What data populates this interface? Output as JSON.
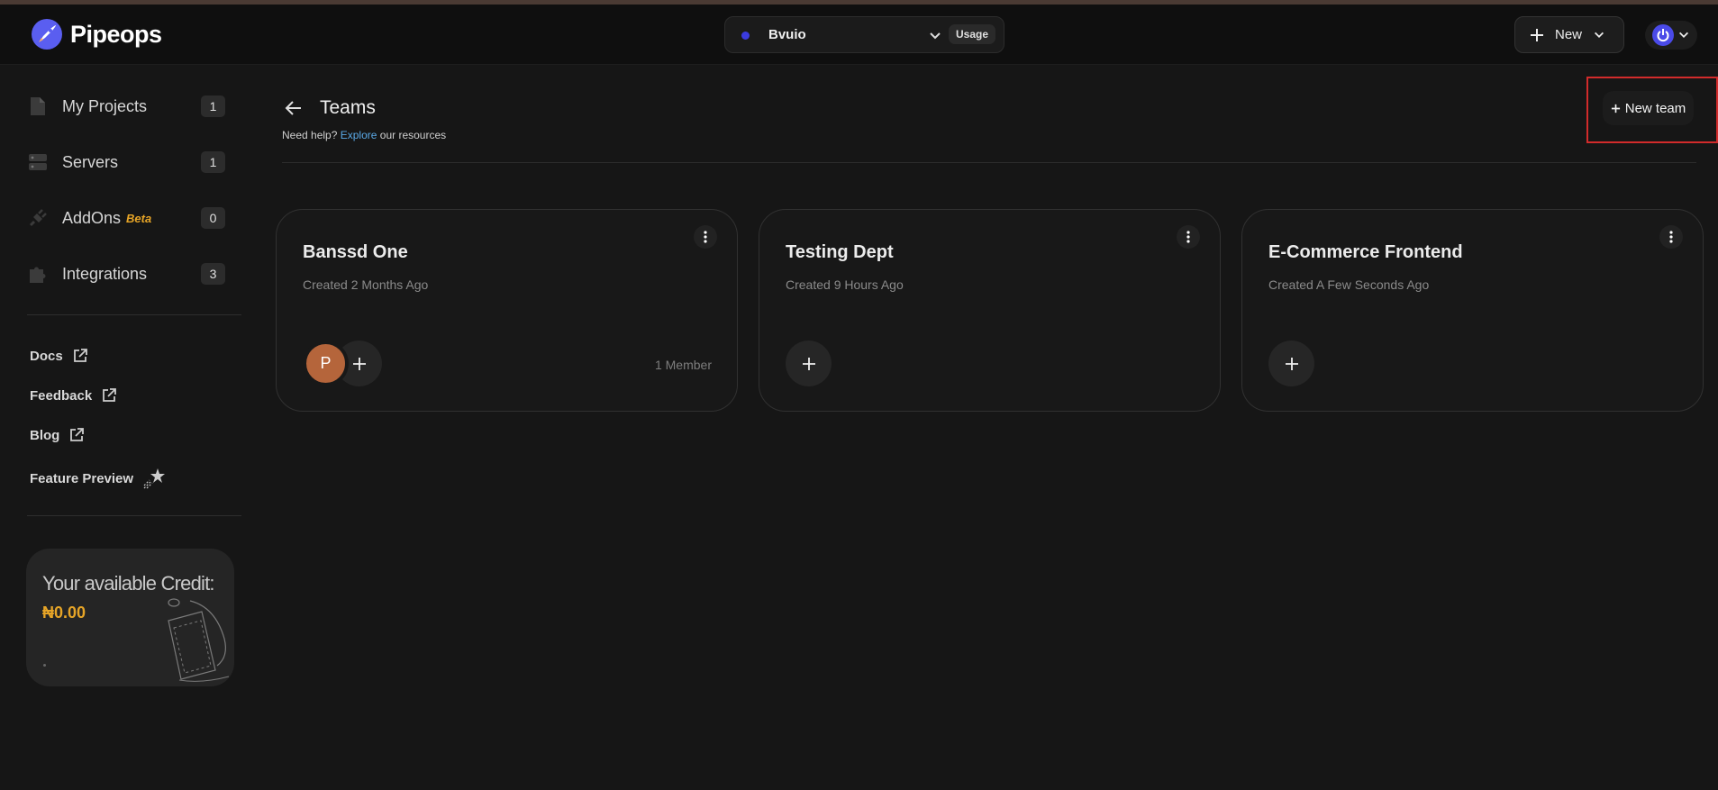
{
  "header": {
    "brand": "Pipeops",
    "project": {
      "name": "Bvuio",
      "usage_label": "Usage",
      "dot_color": "#3b3be0"
    },
    "new_label": "New"
  },
  "sidebar": {
    "items": [
      {
        "label": "My Projects",
        "count": "1",
        "icon": "file-icon"
      },
      {
        "label": "Servers",
        "count": "1",
        "icon": "server-icon"
      },
      {
        "label": "AddOns",
        "badge": "Beta",
        "count": "0",
        "icon": "plug-icon"
      },
      {
        "label": "Integrations",
        "count": "3",
        "icon": "puzzle-icon"
      }
    ],
    "links": [
      {
        "label": "Docs",
        "icon": "external-link-icon"
      },
      {
        "label": "Feedback",
        "icon": "external-link-icon"
      },
      {
        "label": "Blog",
        "icon": "external-link-icon"
      },
      {
        "label": "Feature Preview",
        "icon": "sparkle-star-icon"
      }
    ],
    "credit": {
      "title": "Your available Credit:",
      "value": "₦0.00"
    }
  },
  "main": {
    "title": "Teams",
    "help": {
      "prefix": "Need help?",
      "link": "Explore",
      "suffix": "our resources"
    },
    "new_team_label": "New team",
    "teams": [
      {
        "name": "Banssd One",
        "created": "Created 2 Months Ago",
        "member_initial": "P",
        "member_count": "1 Member"
      },
      {
        "name": "Testing Dept",
        "created": "Created 9 Hours Ago"
      },
      {
        "name": "E-Commerce Frontend",
        "created": "Created A Few Seconds Ago"
      }
    ]
  },
  "colors": {
    "accent": "#e7a527",
    "link": "#5aa9e6",
    "highlight": "#d22b2b",
    "avatar": "#b5653b"
  }
}
